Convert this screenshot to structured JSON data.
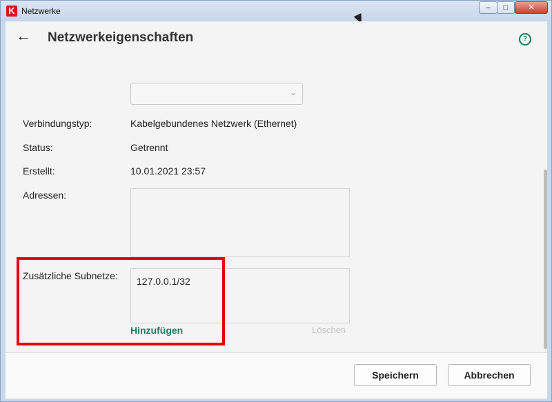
{
  "window": {
    "title": "Netzwerke",
    "app_icon": "K",
    "minimize": "–",
    "maximize": "□",
    "close": "✕"
  },
  "header": {
    "back_icon": "←",
    "title": "Netzwerkeigenschaften",
    "help_icon": "?"
  },
  "network_select": {
    "value": "",
    "chevron": "⌄"
  },
  "fields": {
    "connection_type": {
      "label": "Verbindungstyp:",
      "value": "Kabelgebundenes Netzwerk (Ethernet)"
    },
    "status": {
      "label": "Status:",
      "value": "Getrennt"
    },
    "created": {
      "label": "Erstellt:",
      "value": "10.01.2021 23:57"
    },
    "addresses": {
      "label": "Adressen:",
      "value": ""
    },
    "subnets": {
      "label": "Zusätzliche Subnetze:",
      "entries": [
        "127.0.0.1/32"
      ],
      "add_label": "Hinzufügen",
      "delete_label": "Löschen"
    }
  },
  "footer": {
    "save_label": "Speichern",
    "cancel_label": "Abbrechen"
  },
  "colors": {
    "accent": "#1f7a5e",
    "highlight": "#e60000"
  }
}
